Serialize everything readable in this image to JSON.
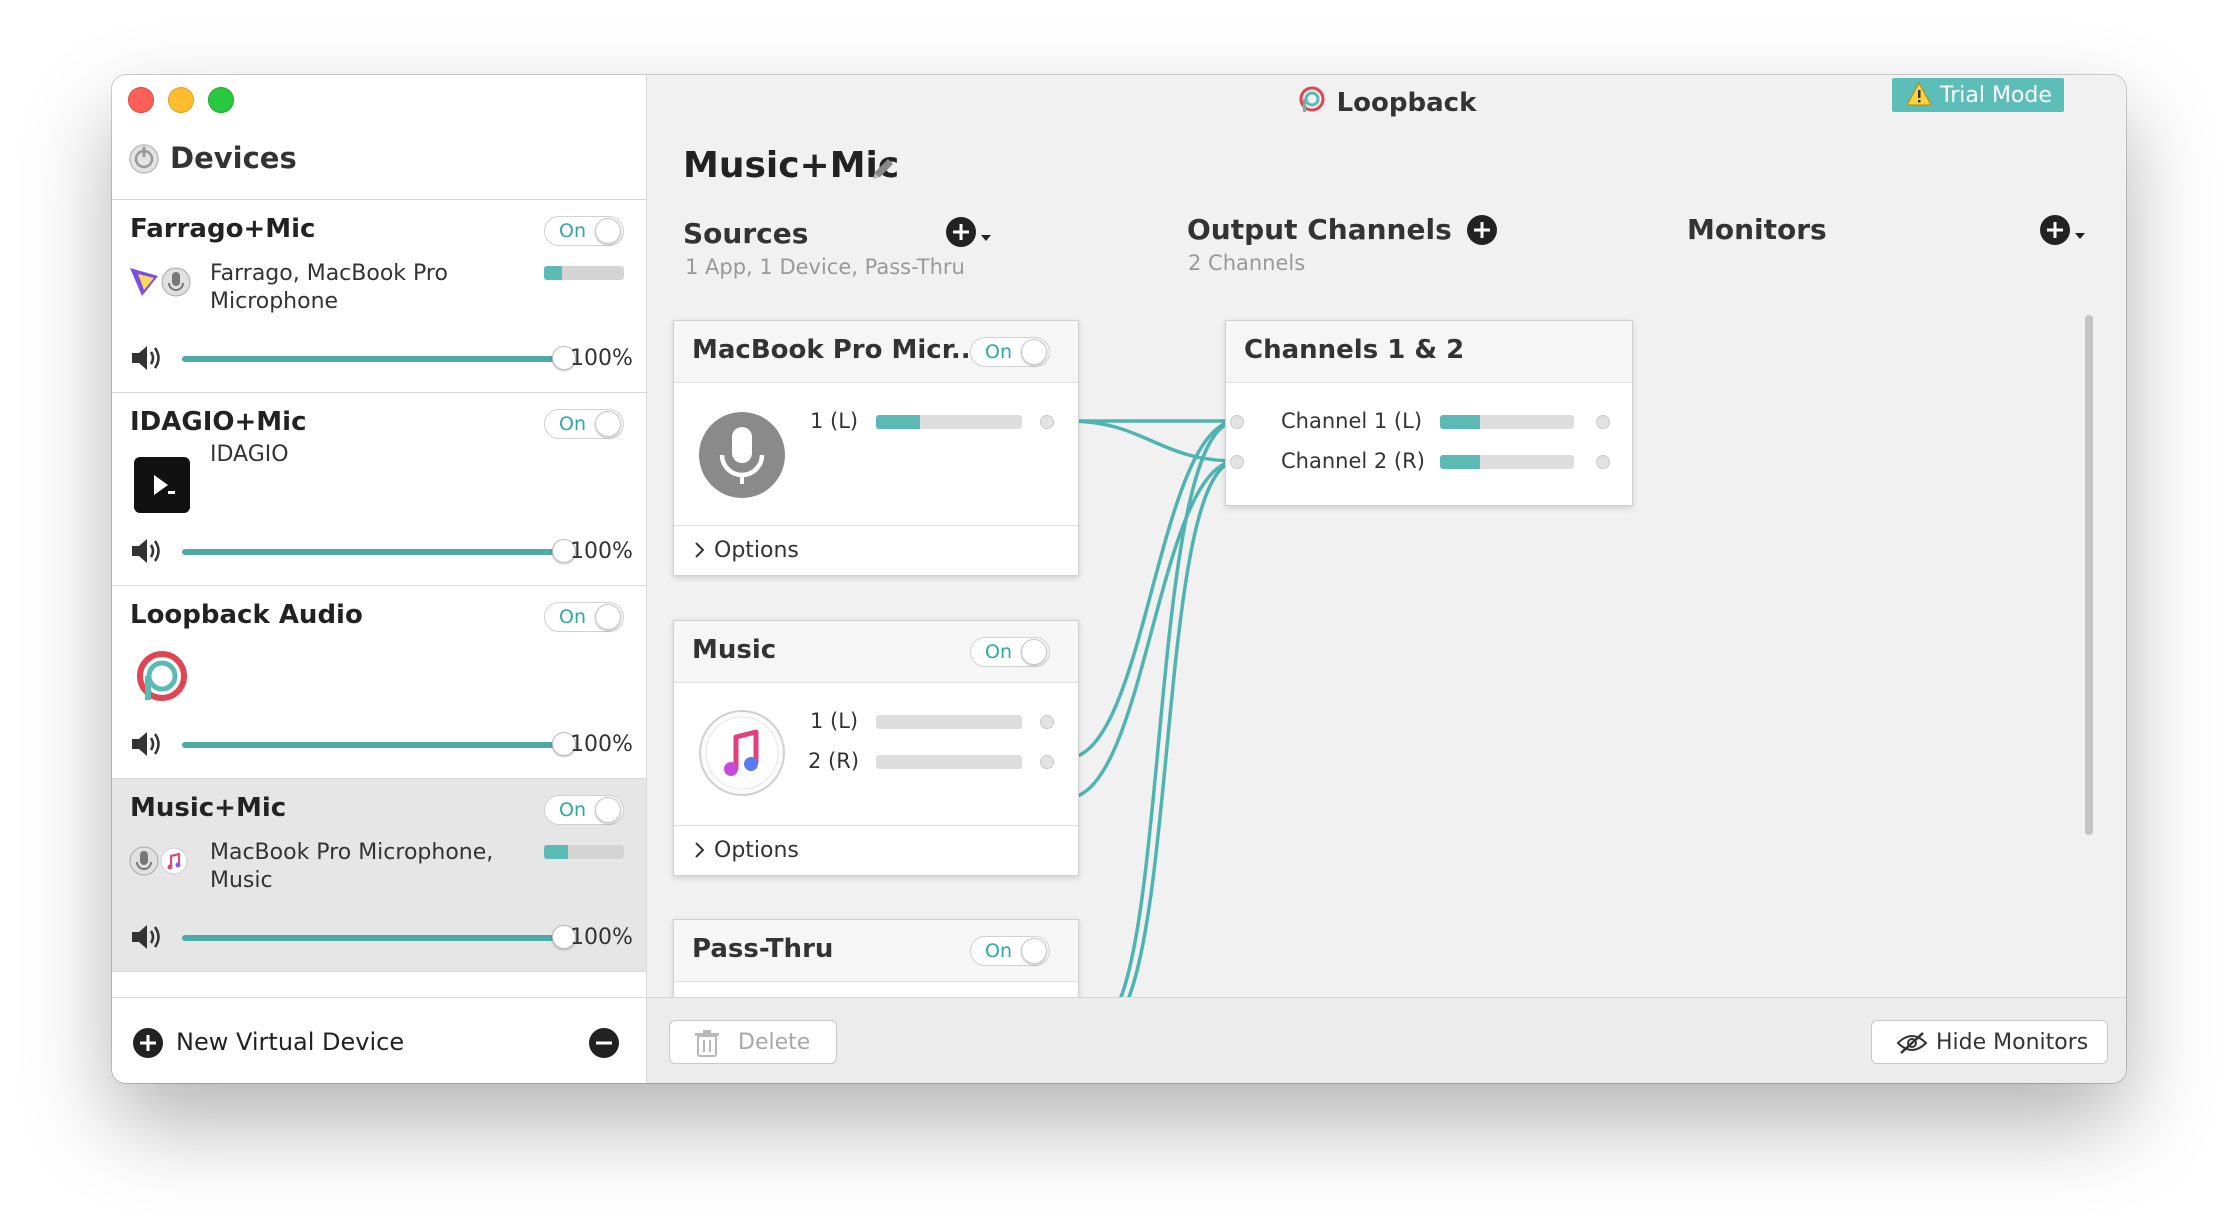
{
  "window": {
    "title": "Loopback",
    "trial_label": "Trial Mode"
  },
  "sidebar": {
    "title": "Devices",
    "devices": [
      {
        "name": "Farrago+Mic",
        "toggle": "On",
        "sources": "Farrago, MacBook Pro Microphone",
        "level": 0.22,
        "volume": "100%"
      },
      {
        "name": "IDAGIO+Mic",
        "toggle": "On",
        "sources": "IDAGIO",
        "volume": "100%"
      },
      {
        "name": "Loopback Audio",
        "toggle": "On",
        "sources": "",
        "volume": "100%"
      },
      {
        "name": "Music+Mic",
        "toggle": "On",
        "sources": "MacBook Pro Microphone, Music",
        "level": 0.3,
        "volume": "100%"
      }
    ],
    "new_device_label": "New Virtual Device"
  },
  "main": {
    "device_title": "Music+Mic",
    "sources": {
      "title": "Sources",
      "subtitle": "1 App, 1 Device, Pass-Thru"
    },
    "outputs": {
      "title": "Output Channels",
      "subtitle": "2 Channels"
    },
    "monitors": {
      "title": "Monitors"
    },
    "source_cards": [
      {
        "title": "MacBook Pro Micr...",
        "toggle": "On",
        "channels": [
          {
            "label": "1 (L)",
            "level": 0.3
          }
        ],
        "options_label": "Options"
      },
      {
        "title": "Music",
        "toggle": "On",
        "channels": [
          {
            "label": "1 (L)",
            "level": 0
          },
          {
            "label": "2 (R)",
            "level": 0
          }
        ],
        "options_label": "Options"
      },
      {
        "title": "Pass-Thru",
        "toggle": "On"
      }
    ],
    "output_card": {
      "title": "Channels 1 & 2",
      "channels": [
        {
          "label": "Channel 1 (L)",
          "level": 0.3
        },
        {
          "label": "Channel 2 (R)",
          "level": 0.3
        }
      ]
    }
  },
  "footer": {
    "delete_label": "Delete",
    "hide_monitors_label": "Hide Monitors"
  },
  "colors": {
    "accent": "#5bbab6",
    "wire": "#4fb3b0"
  }
}
